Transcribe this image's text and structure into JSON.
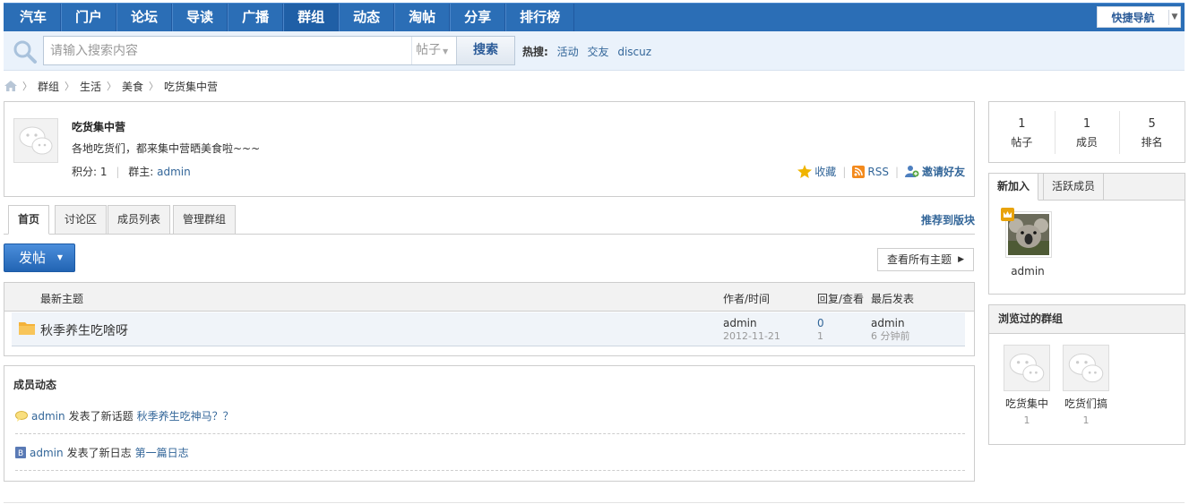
{
  "nav": {
    "items": [
      "汽车",
      "门户",
      "论坛",
      "导读",
      "广播",
      "群组",
      "动态",
      "淘帖",
      "分享",
      "排行榜"
    ],
    "active_index": 5,
    "quick_nav_label": "快捷导航"
  },
  "search": {
    "placeholder": "请输入搜索内容",
    "type_label": "帖子",
    "button_label": "搜索",
    "hot_label": "热搜:",
    "hot_terms": [
      "活动",
      "交友",
      "discuz"
    ]
  },
  "breadcrumb": [
    "群组",
    "生活",
    "美食",
    "吃货集中营"
  ],
  "group": {
    "name": "吃货集中营",
    "description": "各地吃货们，都来集中营晒美食啦~~~",
    "score_label": "积分:",
    "score": "1",
    "owner_label": "群主:",
    "owner": "admin",
    "favorite_label": "收藏",
    "rss_label": "RSS",
    "invite_label": "邀请好友"
  },
  "tabs": [
    "首页",
    "讨论区",
    "成员列表",
    "管理群组"
  ],
  "recommend_label": "推荐到版块",
  "post_button_label": "发帖",
  "view_all_label": "查看所有主题",
  "thread_table": {
    "headers": {
      "topic": "最新主题",
      "author": "作者/时间",
      "reply": "回复/查看",
      "last": "最后发表"
    },
    "rows": [
      {
        "title": "秋季养生吃啥呀",
        "author": "admin",
        "date": "2012-11-21",
        "replies": "0",
        "views": "1",
        "last_user": "admin",
        "last_time": "6 分钟前"
      }
    ]
  },
  "activity": {
    "title": "成员动态",
    "items": [
      {
        "user": "admin",
        "action": "发表了新话题",
        "link": "秋季养生吃神马？？",
        "icon": "speech-bubble-icon"
      },
      {
        "user": "admin",
        "action": "发表了新日志",
        "link": "第一篇日志",
        "icon": "blog-icon"
      }
    ]
  },
  "stats": [
    {
      "num": "1",
      "label": "帖子"
    },
    {
      "num": "1",
      "label": "成员"
    },
    {
      "num": "5",
      "label": "排名"
    }
  ],
  "members": {
    "tabs": [
      "新加入",
      "活跃成员"
    ],
    "list": [
      {
        "name": "admin"
      }
    ]
  },
  "visited": {
    "title": "浏览过的群组",
    "groups": [
      {
        "name": "吃货集中",
        "count": "1"
      },
      {
        "name": "吃货们搞",
        "count": "1"
      }
    ]
  },
  "colors": {
    "nav_bg": "#2b6eb6",
    "link": "#336699",
    "post_button": "#2264b3"
  }
}
